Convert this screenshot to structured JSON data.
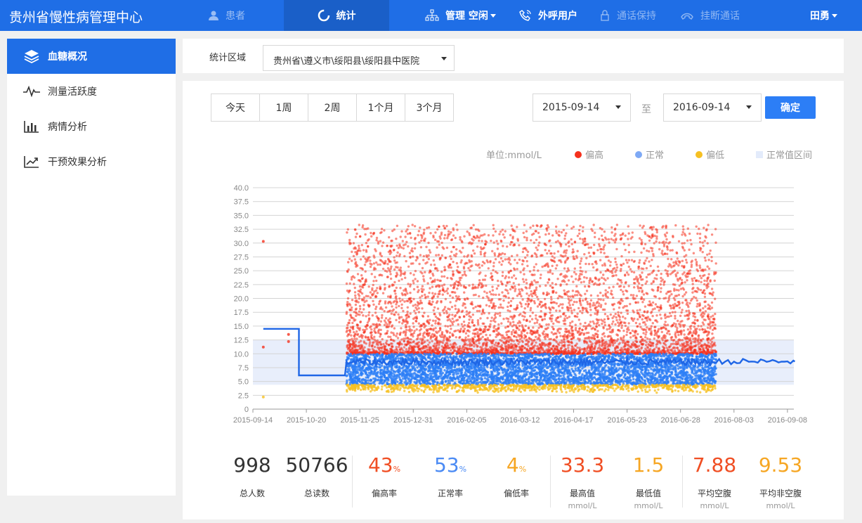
{
  "app": {
    "title": "贵州省慢性病管理中心"
  },
  "nav": {
    "patients": "患者",
    "stats": "统计",
    "manage_status": "管理 空闲",
    "outbound": "外呼用户",
    "hold": "通话保持",
    "hangup": "挂断通话",
    "user": "田勇"
  },
  "sidebar": {
    "items": [
      {
        "label": "血糖概况",
        "icon": "layers-icon",
        "active": true
      },
      {
        "label": "测量活跃度",
        "icon": "pulse-icon",
        "active": false
      },
      {
        "label": "病情分析",
        "icon": "bar-chart-icon",
        "active": false
      },
      {
        "label": "干预效果分析",
        "icon": "trend-chart-icon",
        "active": false
      }
    ]
  },
  "filter": {
    "region_label": "统计区域",
    "region_value": "贵州省\\遵义市\\绥阳县\\绥阳县中医院"
  },
  "range": {
    "buttons": [
      "今天",
      "1周",
      "2周",
      "1个月",
      "3个月"
    ]
  },
  "dates": {
    "start": "2015-09-14",
    "separator": "至",
    "end": "2016-09-14",
    "confirm": "确定"
  },
  "legend": {
    "unit": "单位:mmol/L",
    "high": "偏高",
    "normal": "正常",
    "low": "偏低",
    "normal_range": "正常值区间"
  },
  "colors": {
    "high": "#f5311d",
    "normal": "#2c7ef6",
    "low": "#f6c022",
    "band": "#e8eefb",
    "accent": "#1f6ee6"
  },
  "chart_data": {
    "type": "scatter",
    "x_ticks": [
      "2015-09-14",
      "2015-10-20",
      "2015-11-25",
      "2015-12-31",
      "2016-02-05",
      "2016-03-12",
      "2016-04-17",
      "2016-05-23",
      "2016-06-28",
      "2016-08-03",
      "2016-09-08"
    ],
    "y_ticks": [
      "0",
      "2.5",
      "5.0",
      "7.5",
      "10.0",
      "12.5",
      "15.0",
      "17.5",
      "20.0",
      "22.5",
      "25.0",
      "27.5",
      "30.0",
      "32.5",
      "35.0",
      "37.5",
      "40.0"
    ],
    "ylim": [
      0,
      40
    ],
    "normal_band": [
      4.4,
      12.5
    ],
    "series": [
      {
        "name": "偏高",
        "kind": "scatter",
        "range": [
          10,
          33.3
        ]
      },
      {
        "name": "正常",
        "kind": "scatter",
        "range": [
          4.4,
          10
        ]
      },
      {
        "name": "偏低",
        "kind": "scatter",
        "range": [
          1.5,
          4.4
        ]
      }
    ],
    "dense_period": [
      "2015-11-16",
      "2016-07-22"
    ],
    "mean_line": [
      {
        "x": "2015-09-21",
        "y": 14.5
      },
      {
        "x": "2015-10-15",
        "y": 14.5
      },
      {
        "x": "2015-10-15",
        "y": 6.1
      },
      {
        "x": "2015-11-15",
        "y": 6.1
      },
      {
        "x": "2015-11-16",
        "y": 8.6
      },
      {
        "x": "2016-07-22",
        "y": 8.4
      },
      {
        "x": "2016-09-13",
        "y": 8.6
      }
    ]
  },
  "stats": [
    {
      "value": "998",
      "pct": "",
      "label": "总人数",
      "unit": "",
      "color": "#333333"
    },
    {
      "value": "50766",
      "pct": "",
      "label": "总读数",
      "unit": "",
      "color": "#333333"
    },
    {
      "value": "43",
      "pct": "%",
      "label": "偏高率",
      "unit": "",
      "color": "#f04e23"
    },
    {
      "value": "53",
      "pct": "%",
      "label": "正常率",
      "unit": "",
      "color": "#4a8af4"
    },
    {
      "value": "4",
      "pct": "%",
      "label": "偏低率",
      "unit": "",
      "color": "#f6a623"
    },
    {
      "value": "33.3",
      "pct": "",
      "label": "最高值",
      "unit": "mmol/L",
      "color": "#f04e23"
    },
    {
      "value": "1.5",
      "pct": "",
      "label": "最低值",
      "unit": "mmol/L",
      "color": "#f6a623"
    },
    {
      "value": "7.88",
      "pct": "",
      "label": "平均空腹",
      "unit": "mmol/L",
      "color": "#f04e23"
    },
    {
      "value": "9.53",
      "pct": "",
      "label": "平均非空腹",
      "unit": "mmol/L",
      "color": "#f6a623"
    }
  ]
}
